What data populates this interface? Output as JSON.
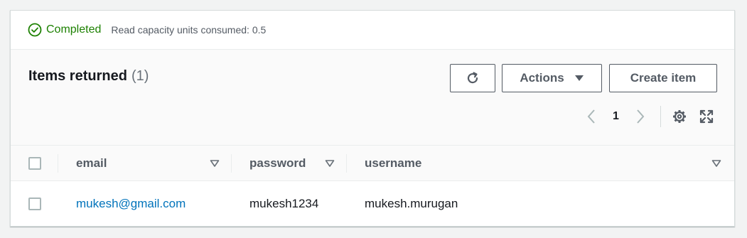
{
  "status": {
    "icon": "check-circle-icon",
    "label": "Completed",
    "detail": "Read capacity units consumed: 0.5",
    "color": "#1d8102"
  },
  "header": {
    "title": "Items returned",
    "count": "(1)",
    "refresh_icon": "refresh-icon",
    "actions_label": "Actions",
    "create_label": "Create item"
  },
  "pagination": {
    "current_page": "1",
    "settings_icon": "gear-icon",
    "fullscreen_icon": "fullscreen-icon"
  },
  "table": {
    "columns": [
      "email",
      "password",
      "username"
    ],
    "rows": [
      {
        "email": "mukesh@gmail.com",
        "password": "mukesh1234",
        "username": "mukesh.murugan"
      }
    ]
  },
  "colors": {
    "link": "#0073bb",
    "success": "#1d8102",
    "button_text": "#545b64"
  }
}
